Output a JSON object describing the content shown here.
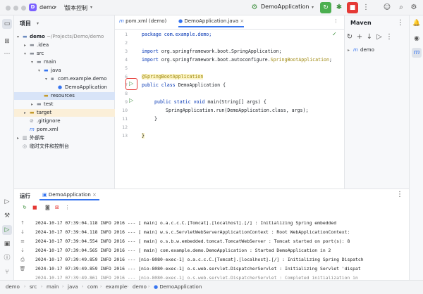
{
  "window": {
    "project_badge": "D",
    "project_name": "demo",
    "vcs_label": "版本控制",
    "run_config": "DemoApplication"
  },
  "project_panel": {
    "title": "项目",
    "tree": [
      {
        "label": "demo",
        "extra": "~/Projects/Demo/demo",
        "arrow": "▾",
        "icon": "folder"
      },
      {
        "label": ".idea",
        "arrow": "▸",
        "icon": "folder"
      },
      {
        "label": "src",
        "arrow": "▾",
        "icon": "folder"
      },
      {
        "label": "main",
        "arrow": "▾",
        "icon": "folder"
      },
      {
        "label": "java",
        "arrow": "▾",
        "icon": "folder"
      },
      {
        "label": "com.example.demo",
        "arrow": "▾",
        "icon": "package"
      },
      {
        "label": "DemoApplication",
        "arrow": "",
        "icon": "class"
      },
      {
        "label": "resources",
        "arrow": "",
        "icon": "folder"
      },
      {
        "label": "test",
        "arrow": "▸",
        "icon": "folder"
      },
      {
        "label": "target",
        "arrow": "▸",
        "icon": "folder"
      },
      {
        "label": ".gitignore",
        "arrow": "",
        "icon": "file"
      },
      {
        "label": "pom.xml",
        "arrow": "",
        "icon": "maven"
      },
      {
        "label": "外部库",
        "arrow": "▸",
        "icon": "library"
      },
      {
        "label": "临时文件和控制台",
        "arrow": "",
        "icon": "scratch"
      }
    ]
  },
  "tabs": [
    {
      "label": "pom.xml (demo)"
    },
    {
      "label": "DemoApplication.java"
    }
  ],
  "editor": {
    "line_numbers": [
      "1",
      "2",
      "3",
      "4",
      "5",
      "6",
      "7",
      "8",
      "9",
      "10",
      "11",
      "12",
      "13"
    ],
    "l1": "package com.example.demo;",
    "l3_kw": "import",
    "l3": " org.springframework.boot.SpringApplication;",
    "l4_kw": "import",
    "l4": " org.springframework.boot.autoconfigure.",
    "l4_ann": "SpringBootApplication",
    "l4_end": ";",
    "l6": "@SpringBootApplication",
    "l7_kw": "public class",
    "l7": " DemoApplication {",
    "l9_kw": "public static void",
    "l9": " main(String[] args) {",
    "l10": "SpringApplication.run(DemoApplication.class, args);",
    "l11": "}",
    "l13": "}"
  },
  "maven": {
    "title": "Maven",
    "item": "demo"
  },
  "run_panel": {
    "title": "运行",
    "tab": "DemoApplication",
    "log": [
      "2024-10-17 07:39:04.118  INFO 2016 --- [           main] o.a.c.c.C.[Tomcat].[localhost].[/]       : Initializing Spring embedded",
      "2024-10-17 07:39:04.118  INFO 2016 --- [           main] w.s.c.ServletWebServerApplicationContext : Root WebApplicationContext:",
      "2024-10-17 07:39:04.554  INFO 2016 --- [           main] o.s.b.w.embedded.tomcat.TomcatWebServer  : Tomcat started on port(s): 8",
      "2024-10-17 07:39:04.565  INFO 2016 --- [           main] com.example.demo.DemoApplication         : Started DemoApplication in 2",
      "2024-10-17 07:39:49.859  INFO 2016 --- [nio-8080-exec-1] o.a.c.c.C.[Tomcat].[localhost].[/]       : Initializing Spring Dispatch",
      "2024-10-17 07:39:49.859  INFO 2016 --- [nio-8080-exec-1] o.s.web.servlet.DispatcherServlet        : Initializing Servlet 'dispat",
      "2024-10-17 07:39:49.861  INFO 2016 --- [nio-8080-exec-1] o.s.web.servlet.DispatcherServlet        : Completed initialization in"
    ]
  },
  "breadcrumb": [
    "demo",
    "src",
    "main",
    "java",
    "com",
    "example",
    "demo",
    "DemoApplication"
  ],
  "colors": {
    "accent": "#3574f0",
    "run_green": "#4caf50",
    "stop_red": "#e53935",
    "highlight_box": "#e53935"
  }
}
